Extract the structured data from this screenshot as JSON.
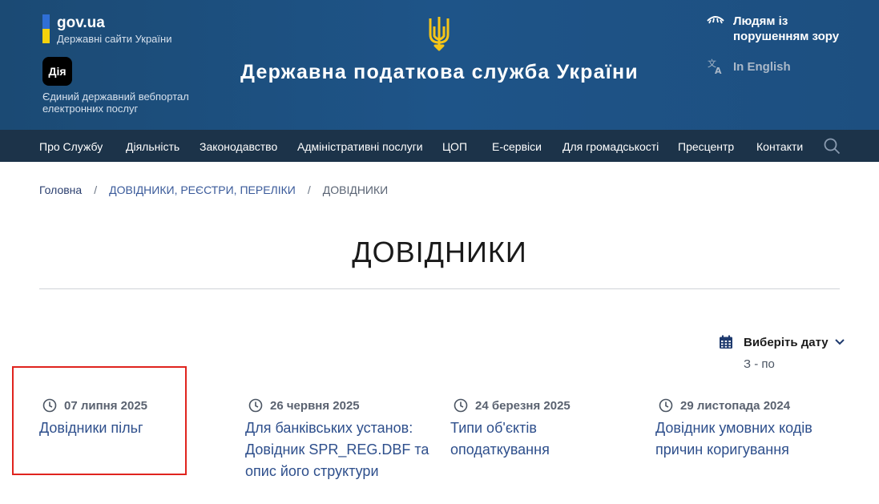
{
  "header": {
    "gov_name": "gov.ua",
    "gov_sub": "Державні сайти України",
    "diia_logo": "Дія",
    "diia_text": "Єдиний державний вебпортал електронних послуг",
    "site_title": "Державна податкова служба України",
    "accessibility_label": "Людям із порушенням зору",
    "language_label": "In English"
  },
  "nav": {
    "items": [
      "Про Службу",
      "Діяльність",
      "Законодавство",
      "Адміністративні послуги",
      "ЦОП",
      "Е-сервіси",
      "Для громадськості",
      "Пресцентр",
      "Контакти"
    ]
  },
  "breadcrumb": {
    "home": "Головна",
    "separator": "/",
    "section": "ДОВІДНИКИ, РЕЄСТРИ, ПЕРЕЛІКИ",
    "current": "ДОВІДНИКИ"
  },
  "page": {
    "title": "ДОВІДНИКИ"
  },
  "filter": {
    "label": "Виберіть дату",
    "range": "З - по"
  },
  "cards": [
    {
      "date": "07 липня 2025",
      "title": "Довідники пільг"
    },
    {
      "date": "26 червня 2025",
      "title": "Для банківських установ: Довідник SPR_REG.DBF та опис його структури"
    },
    {
      "date": "24 березня 2025",
      "title": "Типи об'єктів оподаткування"
    },
    {
      "date": "29 листопада 2024",
      "title": "Довідник умовних кодів причин коригування"
    }
  ],
  "colors": {
    "header_bg": "#1e5488",
    "nav_bg": "#1c3349",
    "link": "#2e4f8c",
    "highlight": "#e0241e",
    "flag_blue": "#2f6fd6",
    "flag_yellow": "#f5d20c",
    "trident": "#f5c518"
  }
}
